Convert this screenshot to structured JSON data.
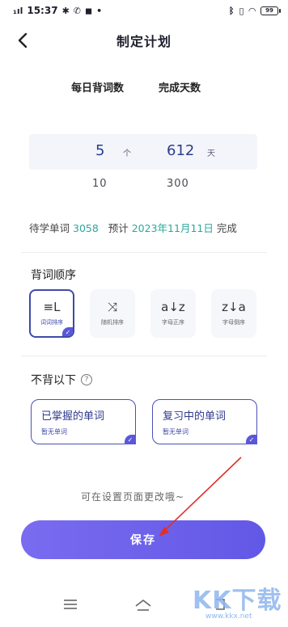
{
  "status_bar": {
    "signal": "₁ıl",
    "time": "15:37",
    "battery": "99"
  },
  "header": {
    "title": "制定计划"
  },
  "picker": {
    "col1_header": "每日背词数",
    "col2_header": "完成天数",
    "selected": {
      "words": "5",
      "words_unit": "个",
      "days": "612",
      "days_unit": "天"
    },
    "next": {
      "words": "10",
      "days": "300"
    }
  },
  "summary": {
    "pending_label": "待学单词",
    "pending_count": "3058",
    "expect_label": "预计",
    "date": "2023年11月11日",
    "done_label": "完成"
  },
  "order_section": {
    "title": "背词顺序",
    "options": [
      {
        "icon": "≡L",
        "label": "词词排序",
        "selected": true
      },
      {
        "icon": "⤨",
        "label": "随机排序",
        "selected": false
      },
      {
        "icon": "a↓z",
        "label": "字母正序",
        "selected": false
      },
      {
        "icon": "z↓a",
        "label": "字母倒序",
        "selected": false
      }
    ]
  },
  "skip_section": {
    "title": "不背以下",
    "help_icon": "?",
    "options": [
      {
        "title": "已掌握的单词",
        "subtitle": "暂无单词",
        "selected": true
      },
      {
        "title": "复习中的单词",
        "subtitle": "暂无单词",
        "selected": true
      }
    ]
  },
  "hint": "可在设置页面更改哦~",
  "save_label": "保存",
  "watermark": {
    "text": "KK下载",
    "url": "www.kkx.net"
  },
  "colors": {
    "accent": "#6258e6",
    "teal": "#2aa89a",
    "card_border": "#4b51b5"
  }
}
